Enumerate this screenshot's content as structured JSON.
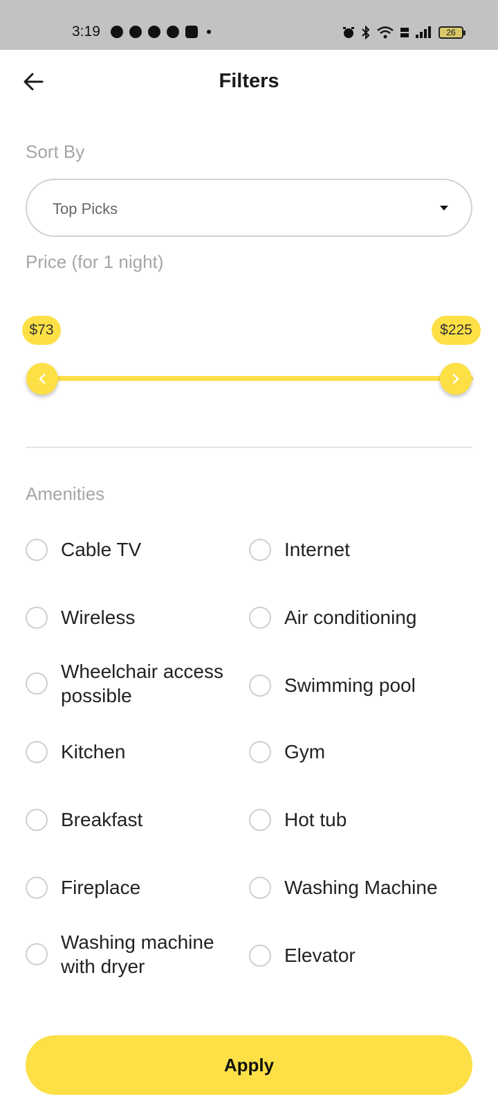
{
  "status_bar": {
    "time": "3:19",
    "battery": "26"
  },
  "header": {
    "title": "Filters"
  },
  "sort": {
    "label": "Sort By",
    "selected": "Top Picks"
  },
  "price": {
    "label": "Price (for 1 night)",
    "min_label": "$73",
    "max_label": "$225"
  },
  "amenities": {
    "label": "Amenities",
    "items": [
      "Cable TV",
      "Internet",
      "Wireless",
      "Air conditioning",
      "Wheelchair access possible",
      "Swimming pool",
      "Kitchen",
      "Gym",
      "Breakfast",
      "Hot tub",
      "Fireplace",
      "Washing Machine",
      "Washing machine with dryer",
      "Elevator"
    ]
  },
  "apply_label": "Apply",
  "colors": {
    "accent": "#fde046",
    "muted_label": "#a6a6a6",
    "status_bar": "#c2c2c2"
  }
}
